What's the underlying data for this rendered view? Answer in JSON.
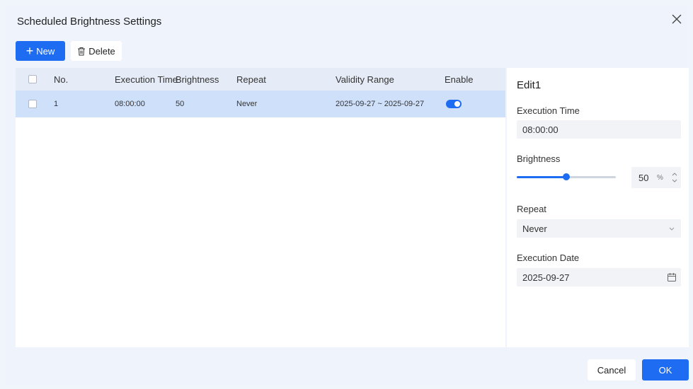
{
  "dialog": {
    "title": "Scheduled Brightness Settings",
    "close_icon": "close-icon"
  },
  "toolbar": {
    "new_label": "New",
    "delete_label": "Delete",
    "new_icon": "plus-icon",
    "delete_icon": "trash-icon"
  },
  "table": {
    "columns": {
      "no": "No.",
      "execution_time": "Execution Time",
      "brightness": "Brightness",
      "repeat": "Repeat",
      "validity_range": "Validity Range",
      "enable": "Enable"
    },
    "rows": [
      {
        "no": "1",
        "execution_time": "08:00:00",
        "brightness": "50",
        "repeat": "Never",
        "validity_range": "2025-09-27 ~ 2025-09-27",
        "enabled": true,
        "selected": true
      }
    ]
  },
  "editor": {
    "title": "Edit1",
    "execution_time_label": "Execution Time",
    "execution_time_value": "08:00:00",
    "brightness_label": "Brightness",
    "brightness_value": "50",
    "brightness_unit": "%",
    "brightness_fraction": 0.5,
    "repeat_label": "Repeat",
    "repeat_value": "Never",
    "execution_date_label": "Execution Date",
    "execution_date_value": "2025-09-27"
  },
  "footer": {
    "cancel_label": "Cancel",
    "ok_label": "OK"
  },
  "colors": {
    "accent": "#1e6cf2",
    "selected_row": "#cfe0fb",
    "header_bg": "#e6ecf7",
    "dialog_bg": "#eef3fc"
  }
}
